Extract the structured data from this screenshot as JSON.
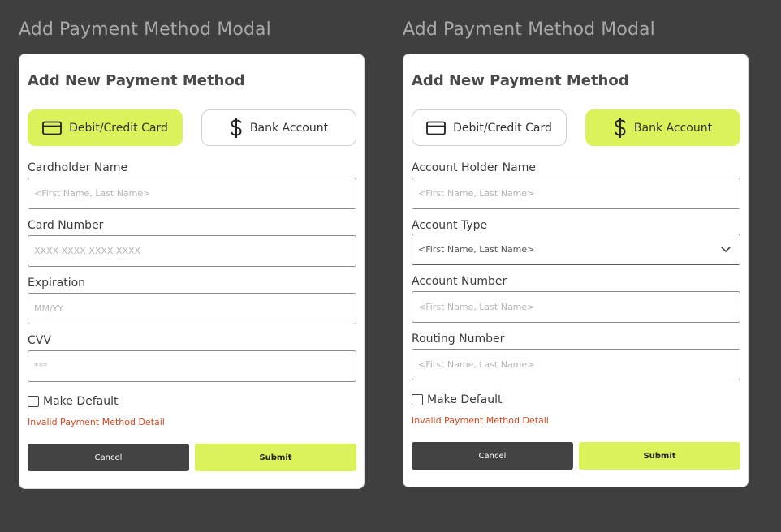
{
  "frames": [
    {
      "frame_title": "Add Payment Method Modal",
      "modal_title": "Add New Payment Method",
      "tabs": [
        {
          "label": "Debit/Credit Card",
          "icon": "credit-card-icon",
          "active": true
        },
        {
          "label": "Bank Account",
          "icon": "dollar-icon",
          "active": false
        }
      ],
      "fields": [
        {
          "label": "Cardholder Name",
          "placeholder": "<First Name, Last Name>"
        },
        {
          "label": "Card Number",
          "placeholder": "XXXX XXXX XXXX XXXX"
        },
        {
          "label": "Expiration",
          "placeholder": "MM/YY"
        },
        {
          "label": "CVV",
          "placeholder": "***"
        }
      ],
      "checkbox_label": "Make Default",
      "error_text": "Invalid Payment Method Detail",
      "cancel_label": "Cancel",
      "submit_label": "Submit"
    },
    {
      "frame_title": "Add Payment Method Modal",
      "modal_title": "Add New Payment Method",
      "tabs": [
        {
          "label": "Debit/Credit Card",
          "icon": "credit-card-icon",
          "active": false
        },
        {
          "label": "Bank Account",
          "icon": "dollar-icon",
          "active": true
        }
      ],
      "fields": [
        {
          "label": "Account Holder Name",
          "placeholder": "<First Name, Last Name>"
        },
        {
          "label": "Account Type",
          "value": "<First Name, Last Name>",
          "type": "select"
        },
        {
          "label": "Account Number",
          "placeholder": "<First Name, Last Name>"
        },
        {
          "label": "Routing Number",
          "placeholder": "<First Name, Last Name>"
        }
      ],
      "checkbox_label": "Make Default",
      "error_text": "Invalid Payment Method Detail",
      "cancel_label": "Cancel",
      "submit_label": "Submit"
    }
  ],
  "colors": {
    "background": "#3f3f3f",
    "accent": "#dcf25a",
    "error": "#d24a1f",
    "cancel": "#434343"
  }
}
